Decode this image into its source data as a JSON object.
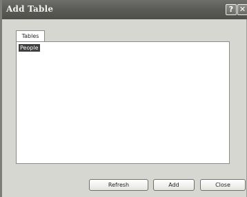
{
  "window": {
    "title": "Add Table",
    "help_glyph": "?",
    "close_glyph": "✕"
  },
  "tabs": [
    {
      "label": "Tables"
    }
  ],
  "table_list": {
    "items": [
      {
        "label": "People",
        "selected": true
      }
    ]
  },
  "buttons": {
    "refresh": "Refresh",
    "add": "Add",
    "close": "Close"
  },
  "colors": {
    "titlebar": "#5c5c59",
    "selection": "#3f3f3f",
    "dialog_background": "#d7d7d2"
  }
}
